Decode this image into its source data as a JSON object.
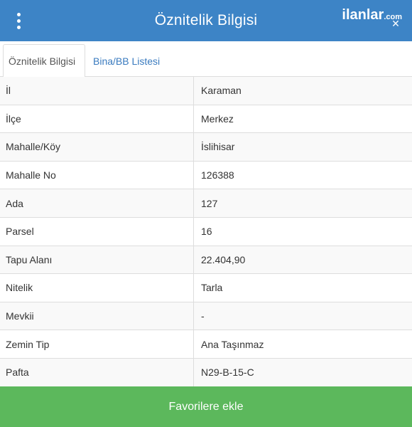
{
  "header": {
    "title": "Öznitelik Bilgisi",
    "brand_name": "ilanlar",
    "brand_suffix": ".com",
    "close_glyph": "✕",
    "menu_icon": "kebab-menu-icon",
    "background": "#3d84c6"
  },
  "tabs": [
    {
      "label": "Öznitelik Bilgisi",
      "active": true
    },
    {
      "label": "Bina/BB Listesi",
      "active": false
    }
  ],
  "rows": [
    {
      "key": "İl",
      "value": "Karaman"
    },
    {
      "key": "İlçe",
      "value": "Merkez"
    },
    {
      "key": "Mahalle/Köy",
      "value": "İslihisar"
    },
    {
      "key": "Mahalle No",
      "value": "126388"
    },
    {
      "key": "Ada",
      "value": "127"
    },
    {
      "key": "Parsel",
      "value": "16"
    },
    {
      "key": "Tapu Alanı",
      "value": "22.404,90"
    },
    {
      "key": "Nitelik",
      "value": "Tarla"
    },
    {
      "key": "Mevkii",
      "value": "-"
    },
    {
      "key": "Zemin Tip",
      "value": "Ana Taşınmaz"
    },
    {
      "key": "Pafta",
      "value": "N29-B-15-C"
    }
  ],
  "footer": {
    "favorite_label": "Favorilere ekle",
    "button_color": "#5cb85c"
  }
}
